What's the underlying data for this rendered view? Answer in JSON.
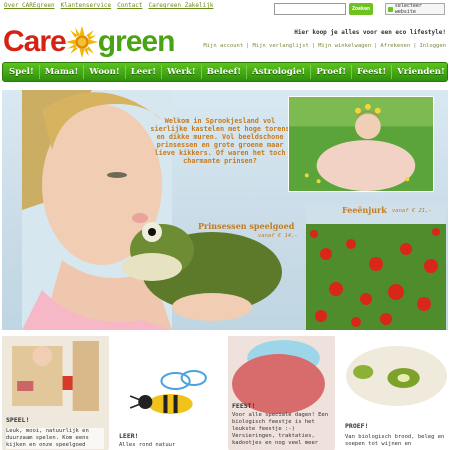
{
  "top_links": [
    "Over CAREgreen",
    "Klantenservice",
    "Contact",
    "Caregreen Zakelijk"
  ],
  "search": {
    "placeholder": "",
    "button": "Zoeken"
  },
  "site_select": "selecteer website",
  "logo": {
    "left": "Care",
    "right": "green"
  },
  "tagline": "Hier koop je alles voor een eco lifestyle!",
  "account_links": [
    "Mijn account",
    "Mijn verlanglijst",
    "Mijn winkelwagen",
    "Afrekenen",
    "Inloggen"
  ],
  "nav": [
    "Spel!",
    "Mama!",
    "Woon!",
    "Leer!",
    "Werk!",
    "Beleef!",
    "Astrologie!",
    "Proef!",
    "Feest!",
    "Vrienden!"
  ],
  "hero": {
    "welcome": "Welkom in Sprookjesland vol sierlijke kastelen met hoge torens en dikke muren. Vol beeldschone prinsessen en grote groene maar lieve kikkers. Of waren het toch charmante prinsen?",
    "caption1": "Prinsessen speelgoed",
    "price1": "vanaf € 14,-",
    "caption2": "Feeënjurk",
    "price2": "vanaf € 21,-"
  },
  "tiles": [
    {
      "title": "SPEEL!",
      "text": "Leuk, mooi, natuurlijk en duurzaam spelen. Kom eens kijken en onze speelgoed"
    },
    {
      "title": "LEER!",
      "text": "Alles rond natuur"
    },
    {
      "title": "FEEST!",
      "text": "Voor alle speciale dagen! Een biologisch feestje is het leukste feestje :-) Versieringen, traktaties, kadootjes en nog veel meer"
    },
    {
      "title": "PROEF!",
      "text": "Van biologisch brood, beleg en soepen tot wijnen en"
    }
  ]
}
